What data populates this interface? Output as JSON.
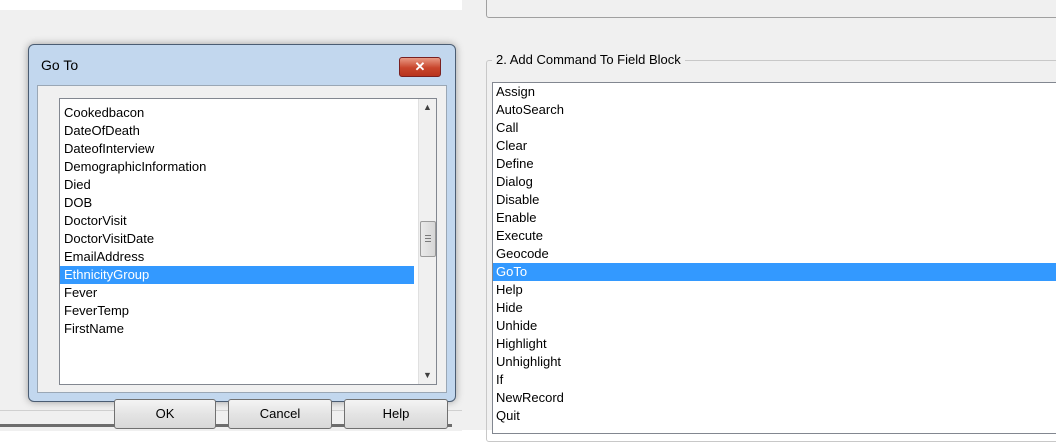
{
  "dialog": {
    "title": "Go To",
    "close_label": "✕",
    "items": [
      "Cookedbacon",
      "DateOfDeath",
      "DateofInterview",
      "DemographicInformation",
      "Died",
      "DOB",
      "DoctorVisit",
      "DoctorVisitDate",
      "EmailAddress",
      "EthnicityGroup",
      "Fever",
      "FeverTemp",
      "FirstName"
    ],
    "selected_item": "EthnicityGroup",
    "buttons": {
      "ok": "OK",
      "cancel": "Cancel",
      "help": "Help"
    },
    "scroll_up_icon": "▲",
    "scroll_down_icon": "▼"
  },
  "panel": {
    "title": "2. Add Command To Field Block",
    "commands": [
      "Assign",
      "AutoSearch",
      "Call",
      "Clear",
      "Define",
      "Dialog",
      "Disable",
      "Enable",
      "Execute",
      "Geocode",
      "GoTo",
      "Help",
      "Hide",
      "Unhide",
      "Highlight",
      "Unhighlight",
      "If",
      "NewRecord",
      "Quit"
    ],
    "selected_command": "GoTo"
  },
  "colors": {
    "selection": "#3399ff",
    "dialog_frame": "#c2d7ee",
    "close_button": "#c8452c"
  }
}
